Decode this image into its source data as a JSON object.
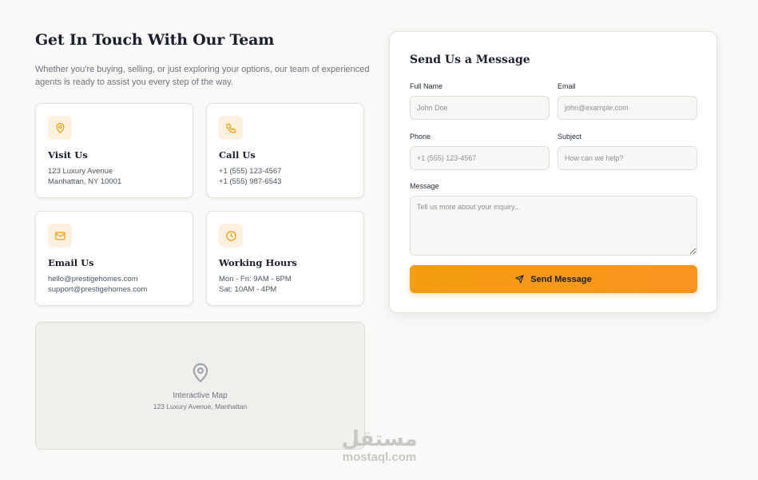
{
  "contact": {
    "heading": "Get In Touch With Our Team",
    "intro_line1": "Whether you're buying, selling, or just exploring your options, our team of experienced",
    "intro_line2": "agents is ready to assist you every step of the way.",
    "cards": [
      {
        "icon": "map-pin-icon",
        "title": "Visit Us",
        "line1": "123 Luxury Avenue",
        "line2": "Manhattan, NY 10001"
      },
      {
        "icon": "phone-icon",
        "title": "Call Us",
        "line1": "+1 (555) 123-4567",
        "line2": "+1 (555) 987-6543"
      },
      {
        "icon": "mail-icon",
        "title": "Email Us",
        "line1": "hello@prestigehomes.com",
        "line2": "support@prestigehomes.com"
      },
      {
        "icon": "clock-icon",
        "title": "Working Hours",
        "line1": "Mon - Fri: 9AM - 6PM",
        "line2": "Sat: 10AM - 4PM"
      }
    ],
    "map": {
      "icon": "map-pin-icon",
      "title": "Interactive Map",
      "subtitle": "123 Luxury Avenue, Manhattan"
    }
  },
  "form": {
    "title": "Send Us a Message",
    "full_name": {
      "label": "Full Name",
      "placeholder": "John Doe"
    },
    "email": {
      "label": "Email",
      "placeholder": "john@example.com"
    },
    "phone": {
      "label": "Phone",
      "placeholder": "+1 (555) 123-4567"
    },
    "subject": {
      "label": "Subject",
      "placeholder": "How can we help?"
    },
    "message": {
      "label": "Message",
      "placeholder": "Tell us more about your inquiry..."
    },
    "submit": {
      "label": "Send Message",
      "icon": "send-icon"
    }
  },
  "watermark": {
    "arabic": "مستقل",
    "latin": "mostaql.com"
  },
  "colors": {
    "accent": "#f59e0b",
    "icon_bg": "#fdf0de",
    "page_bg": "#faf9f7",
    "heading": "#1a1f2e"
  }
}
